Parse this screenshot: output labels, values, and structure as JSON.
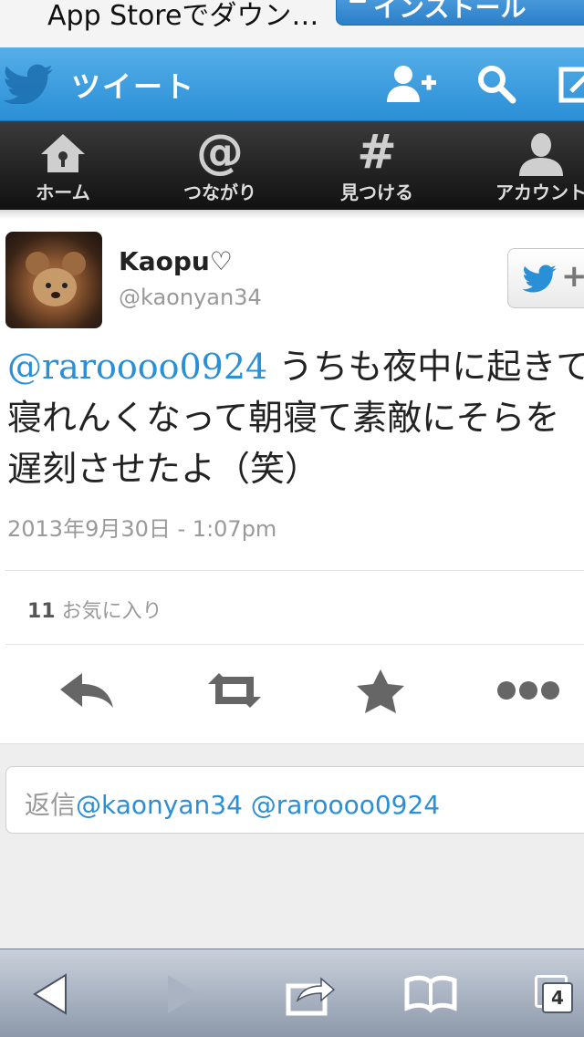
{
  "banner": {
    "text": "App Storeでダウン…",
    "button_label": "インストール"
  },
  "header": {
    "title": "ツイート"
  },
  "nav": {
    "items": [
      {
        "label": "ホーム"
      },
      {
        "label": "つながり"
      },
      {
        "label": "見つける"
      },
      {
        "label": "アカウント"
      }
    ]
  },
  "tweet": {
    "name": "Kaopu♡",
    "handle": "@kaonyan34",
    "mention": "@raroooo0924",
    "lines": [
      " うちも夜中に起きて",
      "寝れんくなって朝寝て素敵にそらを",
      "遅刻させたよ（笑）"
    ],
    "timestamp": "2013年9月30日 - 1:07pm",
    "favorite_count": "11",
    "favorite_label": " お気に入り"
  },
  "reply": {
    "prefix": "返信",
    "mentions": "@kaonyan34 @raroooo0924"
  },
  "toolbar": {
    "tabs_count": "4"
  },
  "colors": {
    "twitter_blue": "#2a8fd6",
    "nav_dark": "#1a1a1a"
  }
}
